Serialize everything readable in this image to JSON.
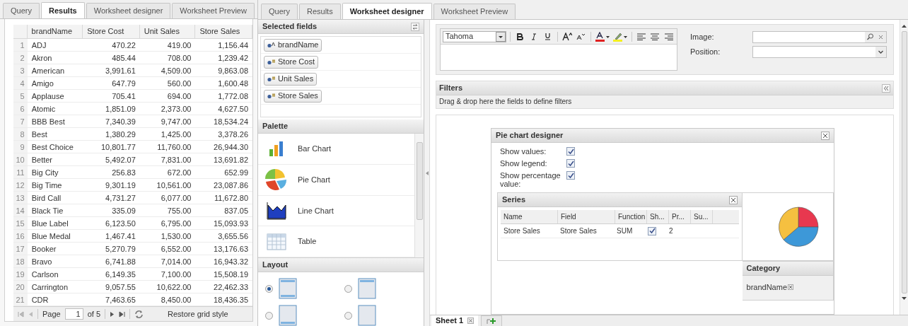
{
  "results_panel": {
    "tabs": [
      {
        "label": "Query",
        "selected": false
      },
      {
        "label": "Results",
        "selected": true
      },
      {
        "label": "Worksheet designer",
        "selected": false
      },
      {
        "label": "Worksheet Preview",
        "selected": false
      }
    ],
    "grid": {
      "columns": [
        "brandName",
        "Store Cost",
        "Unit Sales",
        "Store Sales"
      ],
      "rows": [
        {
          "index": "1",
          "cells": [
            "ADJ",
            "470.22",
            "419.00",
            "1,156.44"
          ]
        },
        {
          "index": "2",
          "cells": [
            "Akron",
            "485.44",
            "708.00",
            "1,239.42"
          ]
        },
        {
          "index": "3",
          "cells": [
            "American",
            "3,991.61",
            "4,509.00",
            "9,863.08"
          ]
        },
        {
          "index": "4",
          "cells": [
            "Amigo",
            "647.79",
            "560.00",
            "1,600.48"
          ]
        },
        {
          "index": "5",
          "cells": [
            "Applause",
            "705.41",
            "694.00",
            "1,772.08"
          ]
        },
        {
          "index": "6",
          "cells": [
            "Atomic",
            "1,851.09",
            "2,373.00",
            "4,627.50"
          ]
        },
        {
          "index": "7",
          "cells": [
            "BBB Best",
            "7,340.39",
            "9,747.00",
            "18,534.24"
          ]
        },
        {
          "index": "8",
          "cells": [
            "Best",
            "1,380.29",
            "1,425.00",
            "3,378.26"
          ]
        },
        {
          "index": "9",
          "cells": [
            "Best Choice",
            "10,801.77",
            "11,760.00",
            "26,944.30"
          ]
        },
        {
          "index": "10",
          "cells": [
            "Better",
            "5,492.07",
            "7,831.00",
            "13,691.82"
          ]
        },
        {
          "index": "11",
          "cells": [
            "Big City",
            "256.83",
            "672.00",
            "652.99"
          ]
        },
        {
          "index": "12",
          "cells": [
            "Big Time",
            "9,301.19",
            "10,561.00",
            "23,087.86"
          ]
        },
        {
          "index": "13",
          "cells": [
            "Bird Call",
            "4,731.27",
            "6,077.00",
            "11,672.80"
          ]
        },
        {
          "index": "14",
          "cells": [
            "Black Tie",
            "335.09",
            "755.00",
            "837.05"
          ]
        },
        {
          "index": "15",
          "cells": [
            "Blue Label",
            "6,123.50",
            "6,795.00",
            "15,093.93"
          ]
        },
        {
          "index": "16",
          "cells": [
            "Blue Medal",
            "1,467.41",
            "1,530.00",
            "3,655.56"
          ]
        },
        {
          "index": "17",
          "cells": [
            "Booker",
            "5,270.79",
            "6,552.00",
            "13,176.63"
          ]
        },
        {
          "index": "18",
          "cells": [
            "Bravo",
            "6,741.88",
            "7,014.00",
            "16,943.32"
          ]
        },
        {
          "index": "19",
          "cells": [
            "Carlson",
            "6,149.35",
            "7,100.00",
            "15,508.19"
          ]
        },
        {
          "index": "20",
          "cells": [
            "Carrington",
            "9,057.55",
            "10,622.00",
            "22,462.33"
          ]
        },
        {
          "index": "21",
          "cells": [
            "CDR",
            "7,463.65",
            "8,450.00",
            "18,436.35"
          ]
        }
      ]
    },
    "pager": {
      "page_label": "Page",
      "page_value": "1",
      "of_label": "of 5",
      "restore_label": "Restore grid style"
    }
  },
  "designer_tabs": [
    {
      "label": "Query",
      "selected": false
    },
    {
      "label": "Results",
      "selected": false
    },
    {
      "label": "Worksheet designer",
      "selected": true
    },
    {
      "label": "Worksheet Preview",
      "selected": false
    }
  ],
  "selected_fields": {
    "title": "Selected fields",
    "fields": [
      {
        "name": "brandName",
        "kind": "text"
      },
      {
        "name": "Store Cost",
        "kind": "number"
      },
      {
        "name": "Unit Sales",
        "kind": "number"
      },
      {
        "name": "Store Sales",
        "kind": "number"
      }
    ]
  },
  "palette": {
    "title": "Palette",
    "items": [
      {
        "label": "Bar Chart",
        "kind": "bar"
      },
      {
        "label": "Pie Chart",
        "kind": "pie"
      },
      {
        "label": "Line Chart",
        "kind": "line"
      },
      {
        "label": "Table",
        "kind": "table"
      }
    ]
  },
  "layout": {
    "title": "Layout",
    "options": [
      {
        "kind": "top-bottom",
        "selected": true
      },
      {
        "kind": "top",
        "selected": false
      },
      {
        "kind": "bottom",
        "selected": false
      },
      {
        "kind": "none",
        "selected": false
      }
    ]
  },
  "editor": {
    "font": "Tahoma",
    "image_label": "Image:",
    "position_label": "Position:"
  },
  "filters": {
    "title": "Filters",
    "hint": "Drag & drop here the fields to define filters"
  },
  "pie_designer": {
    "title": "Pie chart designer",
    "options": [
      {
        "label": "Show values:",
        "checked": true
      },
      {
        "label": "Show legend:",
        "checked": true
      },
      {
        "label": "Show percentage value:",
        "checked": true
      }
    ],
    "series": {
      "title": "Series",
      "columns": [
        "Name",
        "Field",
        "Function",
        "Sh...",
        "Pr...",
        "Su..."
      ],
      "rows": [
        {
          "name": "Store Sales",
          "field": "Store Sales",
          "function": "SUM",
          "show": true,
          "precision": "2"
        }
      ]
    },
    "category": {
      "title": "Category",
      "fields": [
        "brandName"
      ]
    }
  },
  "sheet_tabs": [
    {
      "label": "Sheet 1",
      "selected": true
    }
  ]
}
